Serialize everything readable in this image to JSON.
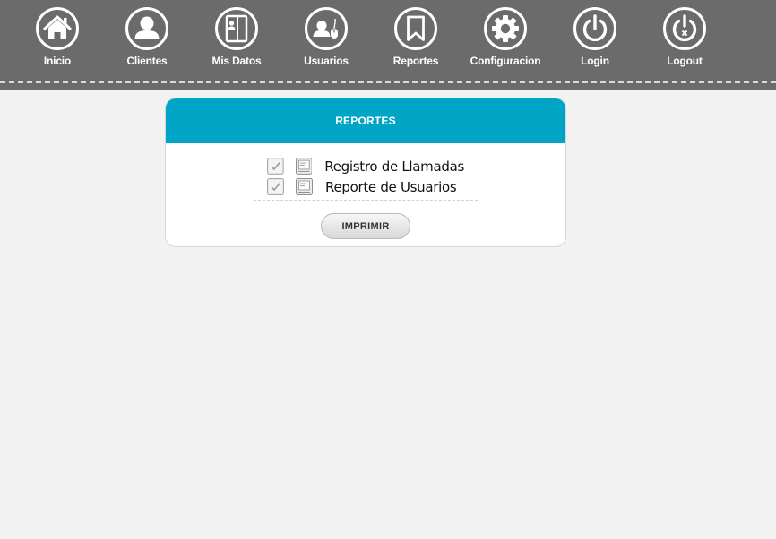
{
  "nav": {
    "items": [
      {
        "label": "Inicio",
        "icon": "home-icon"
      },
      {
        "label": "Clientes",
        "icon": "user-icon"
      },
      {
        "label": "Mis Datos",
        "icon": "contact-book-icon"
      },
      {
        "label": "Usuarios",
        "icon": "user-mouse-icon"
      },
      {
        "label": "Reportes",
        "icon": "bookmark-icon"
      },
      {
        "label": "Configuracion",
        "icon": "gear-icon"
      },
      {
        "label": "Login",
        "icon": "power-icon"
      },
      {
        "label": "Logout",
        "icon": "power-off-icon"
      }
    ]
  },
  "panel": {
    "title": "REPORTES",
    "reports": [
      {
        "label": "Registro de Llamadas",
        "checked": true
      },
      {
        "label": "Reporte de Usuarios",
        "checked": true
      }
    ],
    "print_label": "IMPRIMIR"
  },
  "colors": {
    "topbar": "#6b6b6b",
    "panel_header": "#00a5c6",
    "background": "#f2f2f2"
  }
}
